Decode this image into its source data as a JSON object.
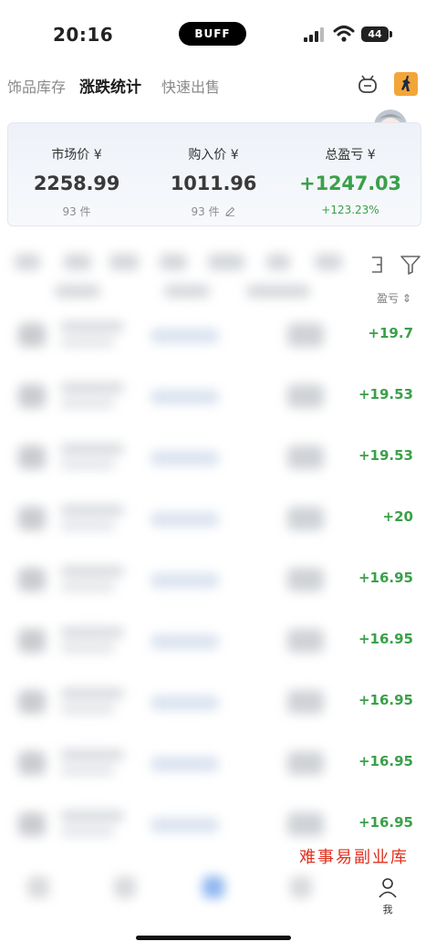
{
  "status": {
    "time": "20:16",
    "island_text": "BUFF",
    "battery": "44"
  },
  "nav": {
    "tabs": [
      {
        "label": "饰品库存",
        "active": false
      },
      {
        "label": "涨跌统计",
        "active": true
      },
      {
        "label": "快速出售",
        "active": false
      }
    ]
  },
  "summary": {
    "market": {
      "label": "市场价 ¥",
      "value": "2258.99",
      "sub": "93 件"
    },
    "purchase": {
      "label": "购入价 ¥",
      "value": "1011.96",
      "sub": "93 件"
    },
    "profit": {
      "label": "总盈亏 ¥",
      "value": "+1247.03",
      "sub": "+123.23%"
    }
  },
  "table": {
    "sort_header": "盈亏 ⇕"
  },
  "rows": [
    {
      "value": "+19.7"
    },
    {
      "value": "+19.53"
    },
    {
      "value": "+19.53"
    },
    {
      "value": "+20"
    },
    {
      "value": "+16.95"
    },
    {
      "value": "+16.95"
    },
    {
      "value": "+16.95"
    },
    {
      "value": "+16.95"
    },
    {
      "value": "+16.95"
    }
  ],
  "watermark": "难事易副业库",
  "bottom_nav": {
    "me_label": "我"
  },
  "colors": {
    "positive": "#3aa04a",
    "accent_orange": "#f3a638",
    "watermark": "#e0301e"
  }
}
